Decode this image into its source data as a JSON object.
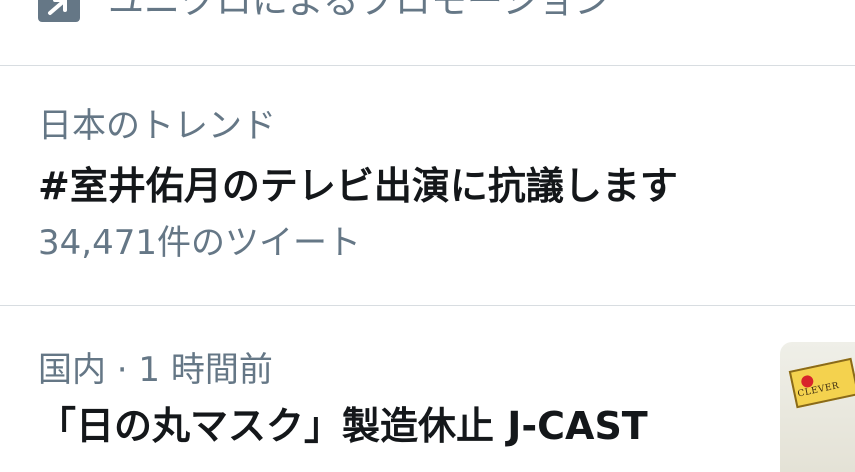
{
  "promo": {
    "icon": "promoted-arrow-icon",
    "text": "ユニクロによるプロモーション"
  },
  "trend": {
    "context": "日本のトレンド",
    "title": "#室井佑月のテレビ出演に抗議します",
    "count": "34,471件のツイート"
  },
  "news": {
    "meta": "国内 · 1 時間前",
    "headline": "「日の丸マスク」製造休止 J-CAST",
    "thumbnail_label": "CLEVER"
  },
  "colors": {
    "secondary_text": "#657786",
    "primary_text": "#14171a",
    "divider": "#d8dde1"
  }
}
